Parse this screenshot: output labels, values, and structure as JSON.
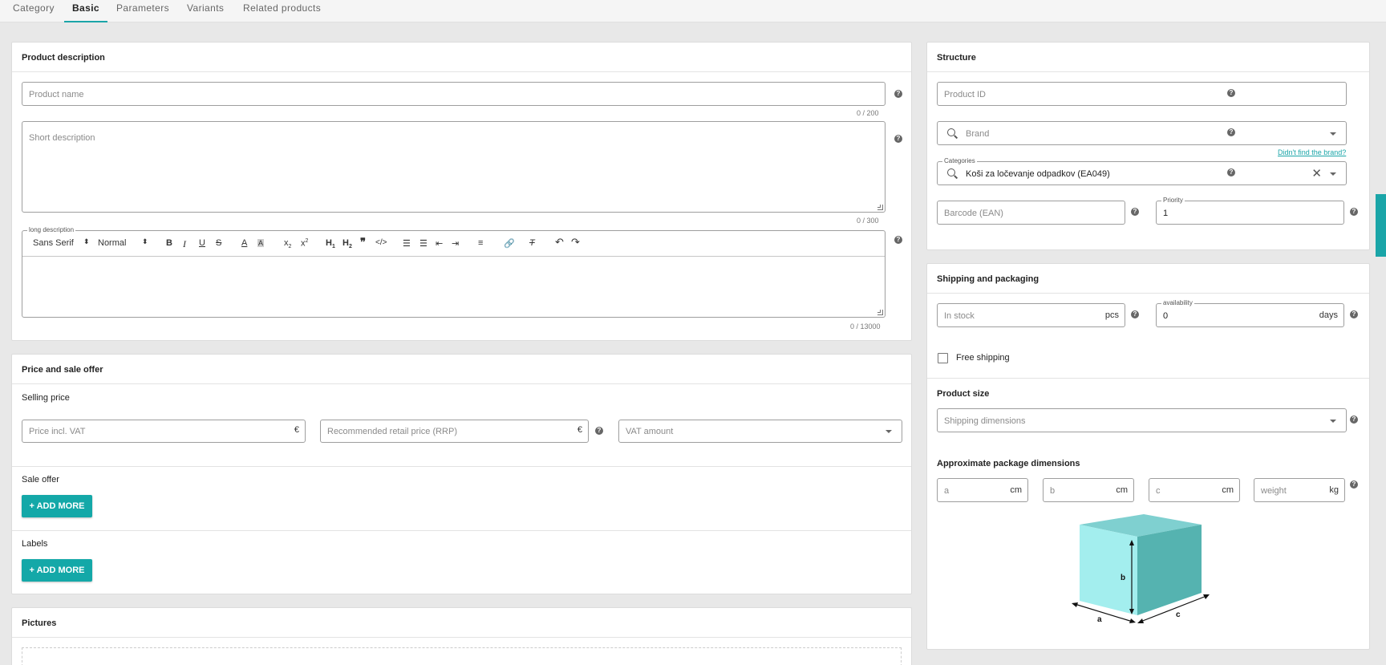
{
  "tabs": [
    "Category",
    "Basic",
    "Parameters",
    "Variants",
    "Related products"
  ],
  "product_description": {
    "title": "Product description",
    "product_name_placeholder": "Product name",
    "product_name_counter": "0 / 200",
    "short_description_placeholder": "Short description",
    "short_description_counter": "0 / 300",
    "long_description_label": "long description",
    "long_description_counter": "0 / 13000",
    "editor": {
      "font": "Sans Serif",
      "size": "Normal",
      "icons": [
        "bold-icon",
        "italic-icon",
        "underline-icon",
        "strike-icon",
        "font-color-icon",
        "background-color-icon",
        "subscript-icon",
        "superscript-icon",
        "heading1-icon",
        "heading2-icon",
        "blockquote-icon",
        "code-icon",
        "ordered-list-icon",
        "bullet-list-icon",
        "outdent-icon",
        "indent-icon",
        "align-icon",
        "link-icon",
        "clear-format-icon",
        "undo-icon",
        "redo-icon"
      ]
    }
  },
  "price": {
    "title": "Price and sale offer",
    "selling_price_label": "Selling price",
    "price_placeholder": "Price incl. VAT",
    "currency": "€",
    "rrp_placeholder": "Recommended retail price (RRP)",
    "vat_placeholder": "VAT amount",
    "sale_offer_label": "Sale offer",
    "add_more": "+ ADD MORE",
    "labels_label": "Labels"
  },
  "pictures": {
    "title": "Pictures"
  },
  "structure": {
    "title": "Structure",
    "product_id_placeholder": "Product ID",
    "brand_placeholder": "Brand",
    "brand_link": "Didn't find the brand?",
    "categories_label": "Categories",
    "categories_value": "Koši za ločevanje odpadkov (EA049)",
    "barcode_placeholder": "Barcode (EAN)",
    "priority_label": "Priority",
    "priority_value": "1"
  },
  "shipping": {
    "title": "Shipping and packaging",
    "in_stock_placeholder": "In stock",
    "in_stock_unit": "pcs",
    "availability_label": "availability",
    "availability_value": "0",
    "availability_unit": "days",
    "free_shipping": "Free shipping",
    "product_size_title": "Product size",
    "shipping_dimensions_placeholder": "Shipping dimensions",
    "approx_title": "Approximate package dimensions",
    "dims": [
      {
        "placeholder": "a",
        "unit": "cm"
      },
      {
        "placeholder": "b",
        "unit": "cm"
      },
      {
        "placeholder": "c",
        "unit": "cm"
      },
      {
        "placeholder": "weight",
        "unit": "kg"
      }
    ],
    "box_labels": {
      "a": "a",
      "b": "b",
      "c": "c"
    }
  },
  "colors": {
    "accent": "#14a8a8",
    "border": "#9e9e9e",
    "background": "#e8e8e8"
  }
}
